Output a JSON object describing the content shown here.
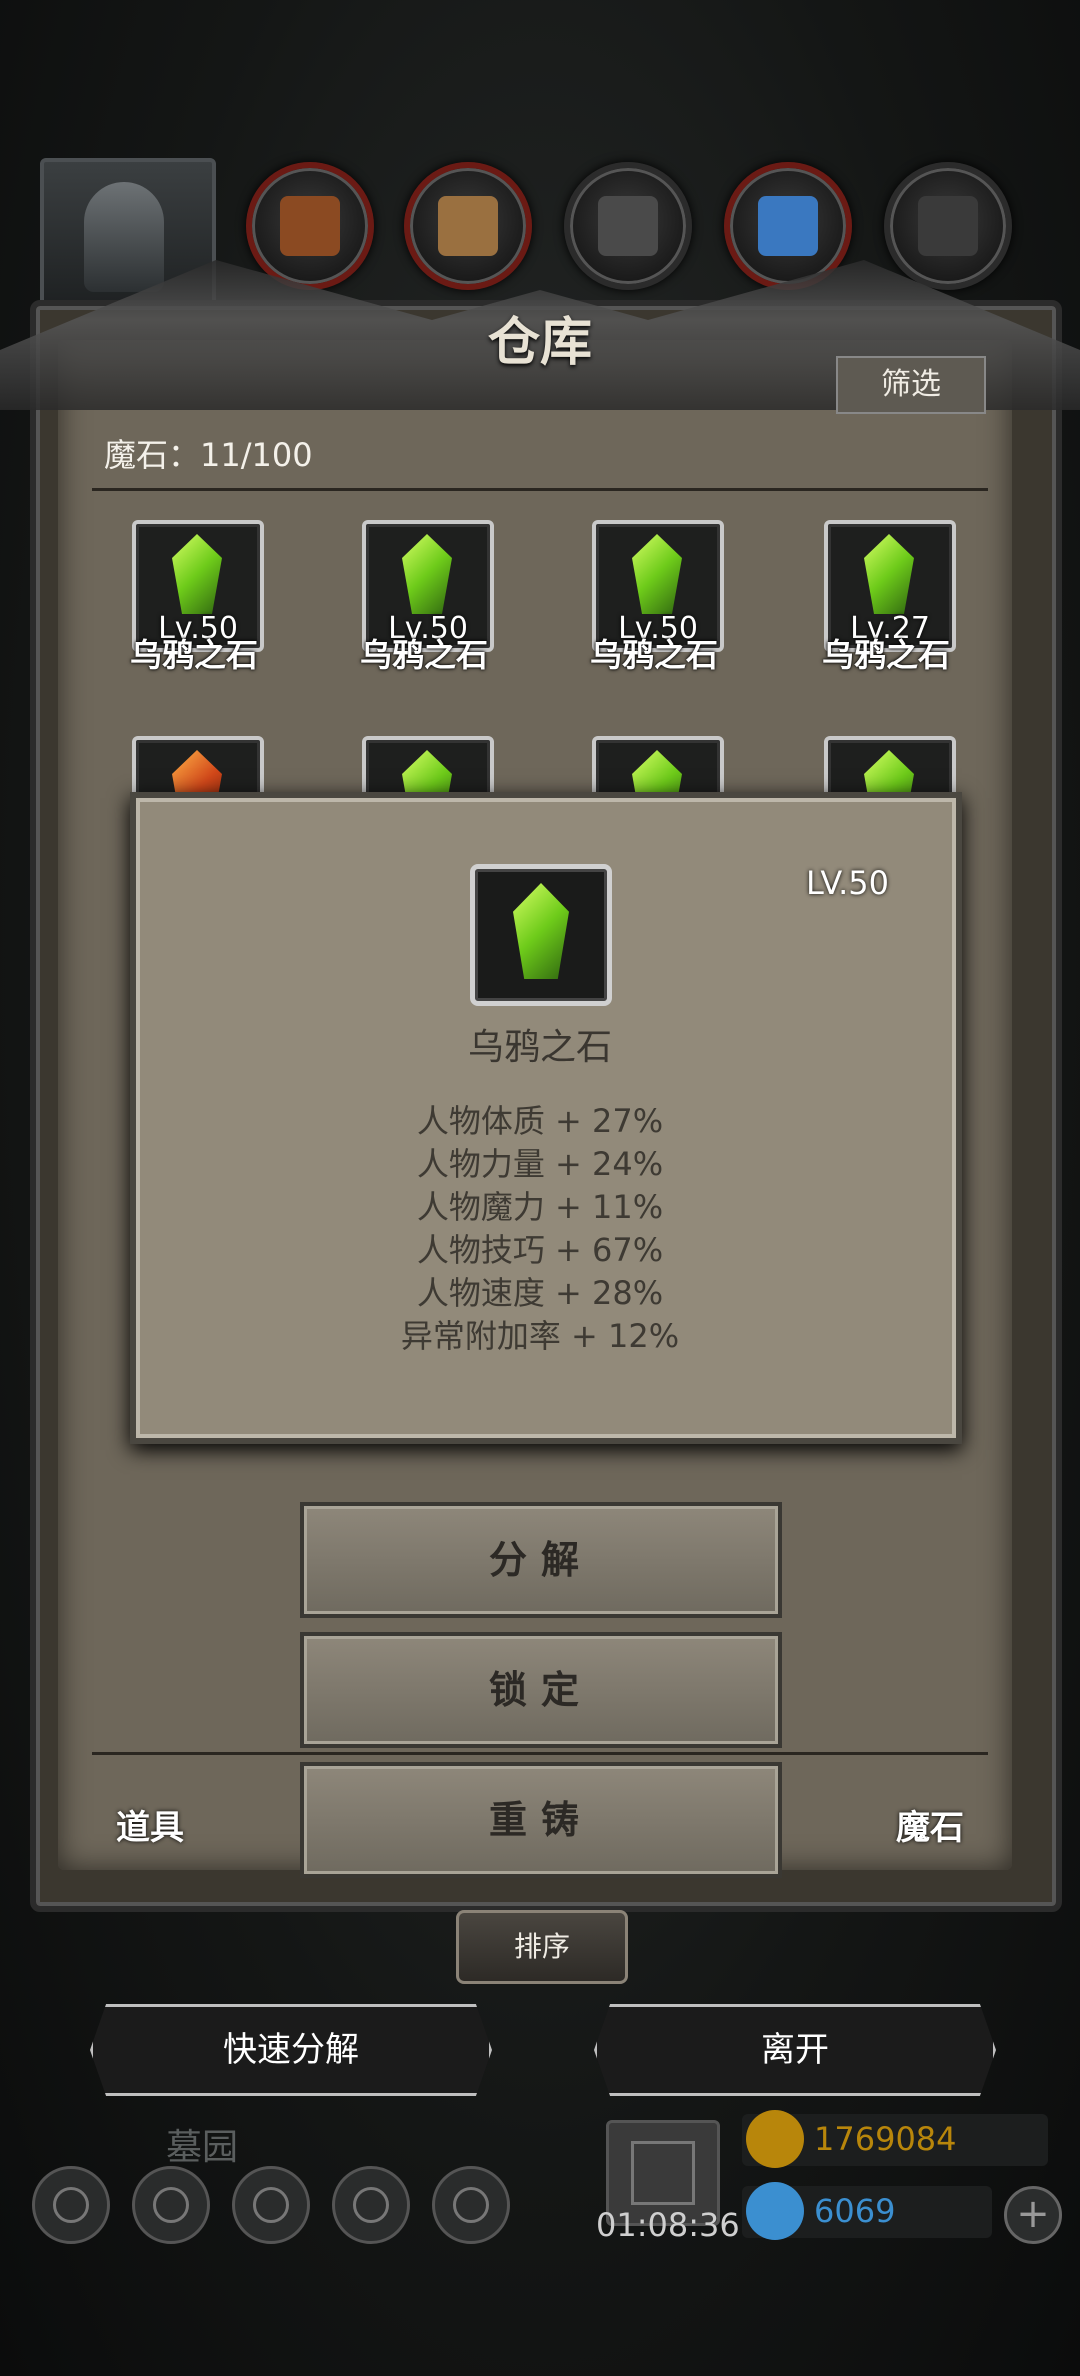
{
  "header": {
    "title": "仓库",
    "filter_label": "筛选",
    "count_label": "魔石：11/100",
    "resources": [
      "red-material-icon",
      "wood-icon",
      "iron-icon",
      "crystal-icon",
      "dark-ore-icon"
    ]
  },
  "grid": {
    "row1": [
      {
        "lv": "Lv.50",
        "name": "乌鸦之石"
      },
      {
        "lv": "Lv.50",
        "name": "乌鸦之石"
      },
      {
        "lv": "Lv.50",
        "name": "乌鸦之石"
      },
      {
        "lv": "Lv.27",
        "name": "乌鸦之石"
      }
    ]
  },
  "tooltip": {
    "lv": "LV.50",
    "name": "乌鸦之石",
    "stats": [
      "人物体质 + 27%",
      "人物力量 + 24%",
      "人物魔力 + 11%",
      "人物技巧 + 67%",
      "人物速度 + 28%",
      "异常附加率 + 12%"
    ]
  },
  "actions": {
    "decompose": "分解",
    "lock": "锁定",
    "reforge": "重铸"
  },
  "tabs": {
    "items": "道具",
    "stones": "魔石"
  },
  "footer": {
    "sort": "排序",
    "quick_decompose": "快速分解",
    "leave": "离开",
    "location": "墓园",
    "timer": "01:08:36",
    "gold": "1769084",
    "gems": "6069",
    "plus": "+"
  },
  "colors": {
    "gold": "#b8860b",
    "gem": "#3b8fd0"
  }
}
